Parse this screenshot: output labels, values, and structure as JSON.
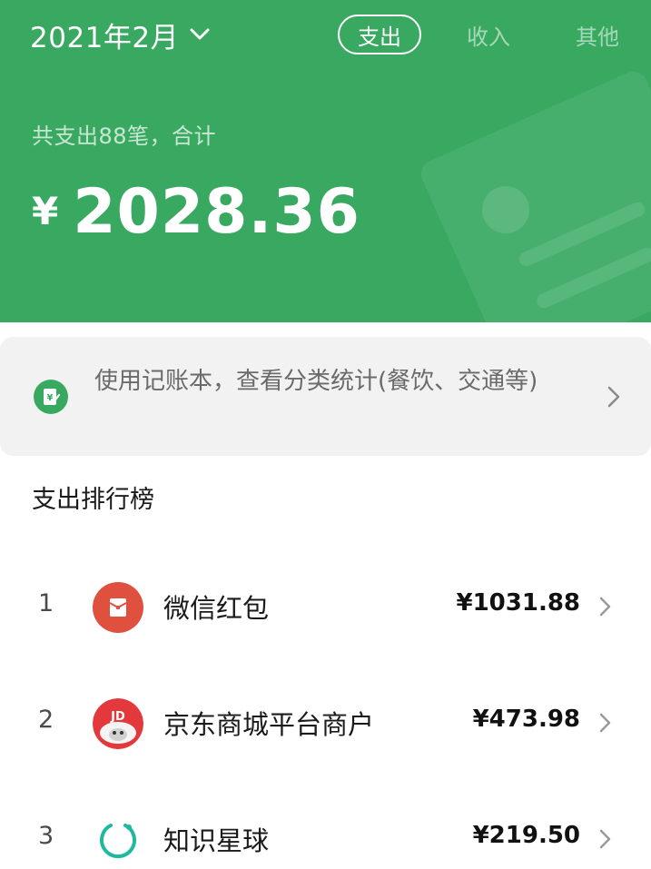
{
  "header": {
    "month": "2021年2月",
    "tabs": [
      {
        "label": "支出",
        "active": true
      },
      {
        "label": "收入",
        "active": false
      },
      {
        "label": "其他",
        "active": false
      }
    ],
    "summary": "共支出88笔，合计",
    "currency": "¥",
    "total": "2028.36",
    "background_color": "#39a962"
  },
  "promo": {
    "text": "使用记账本，查看分类统计(餐饮、交通等)",
    "icon": "ledger-icon"
  },
  "ranking": {
    "title": "支出排行榜",
    "items": [
      {
        "rank": "1",
        "name": "微信红包",
        "amount": "¥1031.88",
        "icon": "red-envelope-icon"
      },
      {
        "rank": "2",
        "name": "京东商城平台商户",
        "amount": "¥473.98",
        "icon": "jd-logo-icon"
      },
      {
        "rank": "3",
        "name": "知识星球",
        "amount": "¥219.50",
        "icon": "knowledge-planet-icon"
      }
    ]
  }
}
